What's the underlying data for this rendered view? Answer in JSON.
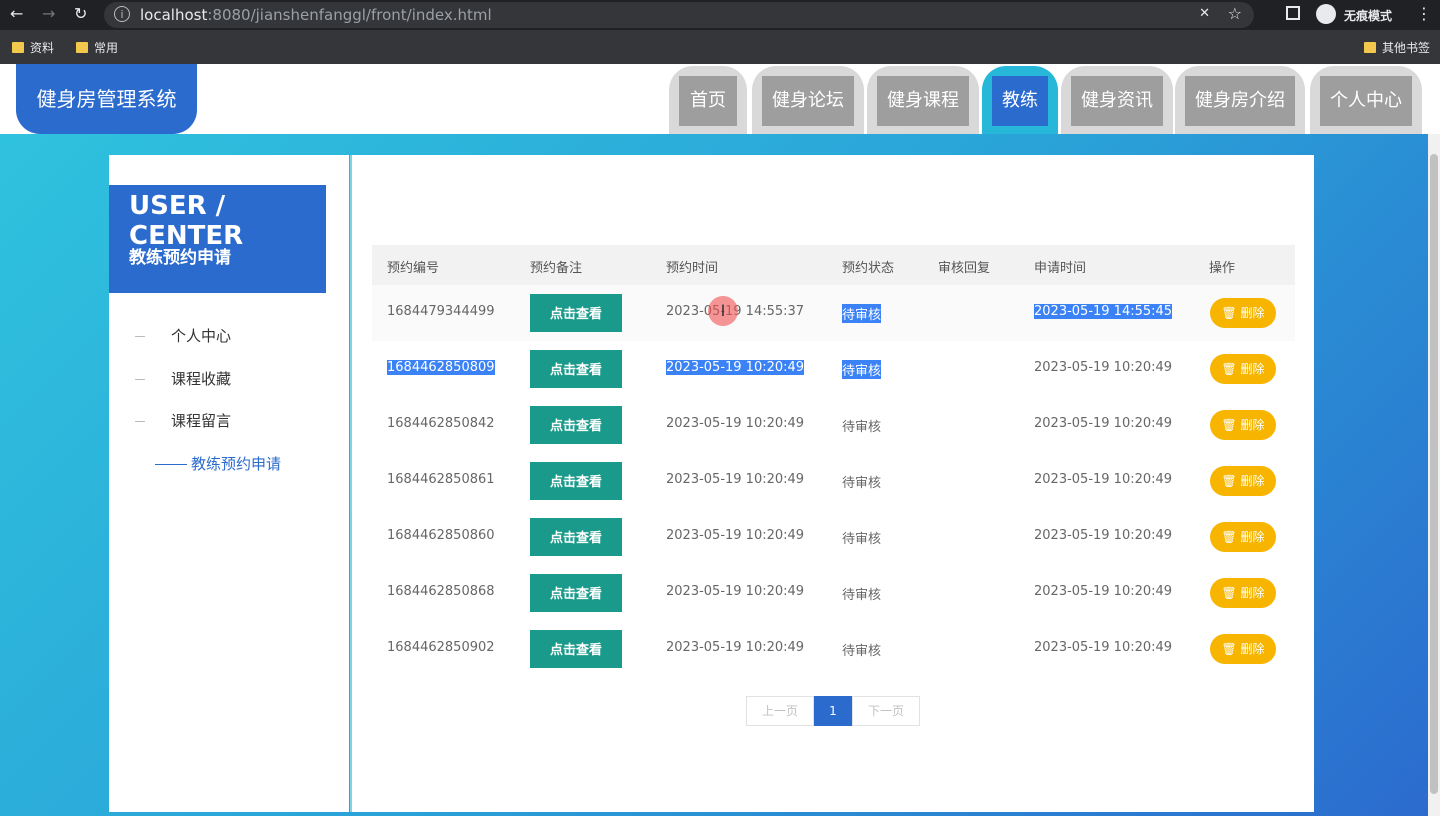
{
  "browser": {
    "url_host": "localhost",
    "url_path": ":8080/jianshenfanggl/front/index.html",
    "incognito_label": "无痕模式",
    "bookmarks": [
      "资料",
      "常用"
    ],
    "other_bookmarks": "其他书签"
  },
  "site": {
    "logo": "健身房管理系统",
    "nav": [
      "首页",
      "健身论坛",
      "健身课程",
      "教练",
      "健身资讯",
      "健身房介绍",
      "个人中心"
    ],
    "active_nav": "教练"
  },
  "sidebar": {
    "title": "USER / CENTER",
    "subtitle": "教练预约申请",
    "items": [
      "个人中心",
      "课程收藏",
      "课程留言",
      "教练预约申请"
    ]
  },
  "table": {
    "headers": [
      "预约编号",
      "预约备注",
      "预约时间",
      "预约状态",
      "审核回复",
      "申请时间",
      "操作"
    ],
    "view_label": "点击查看",
    "delete_label": "删除",
    "rows": [
      {
        "id": "1684479344499",
        "time": "2023-05-19 14:55:37",
        "status": "待审核",
        "reply": "",
        "apply_time": "2023-05-19 14:55:45"
      },
      {
        "id": "1684462850809",
        "time": "2023-05-19 10:20:49",
        "status": "待审核",
        "reply": "",
        "apply_time": "2023-05-19 10:20:49"
      },
      {
        "id": "1684462850842",
        "time": "2023-05-19 10:20:49",
        "status": "待审核",
        "reply": "",
        "apply_time": "2023-05-19 10:20:49"
      },
      {
        "id": "1684462850861",
        "time": "2023-05-19 10:20:49",
        "status": "待审核",
        "reply": "",
        "apply_time": "2023-05-19 10:20:49"
      },
      {
        "id": "1684462850860",
        "time": "2023-05-19 10:20:49",
        "status": "待审核",
        "reply": "",
        "apply_time": "2023-05-19 10:20:49"
      },
      {
        "id": "1684462850868",
        "time": "2023-05-19 10:20:49",
        "status": "待审核",
        "reply": "",
        "apply_time": "2023-05-19 10:20:49"
      },
      {
        "id": "1684462850902",
        "time": "2023-05-19 10:20:49",
        "status": "待审核",
        "reply": "",
        "apply_time": "2023-05-19 10:20:49"
      }
    ]
  },
  "pager": {
    "prev": "上一页",
    "current": "1",
    "next": "下一页"
  },
  "colors": {
    "primary": "#2b6bce",
    "view_button": "#1a9a8a",
    "delete_button": "#f7b500",
    "selection": "#3b82f6"
  }
}
